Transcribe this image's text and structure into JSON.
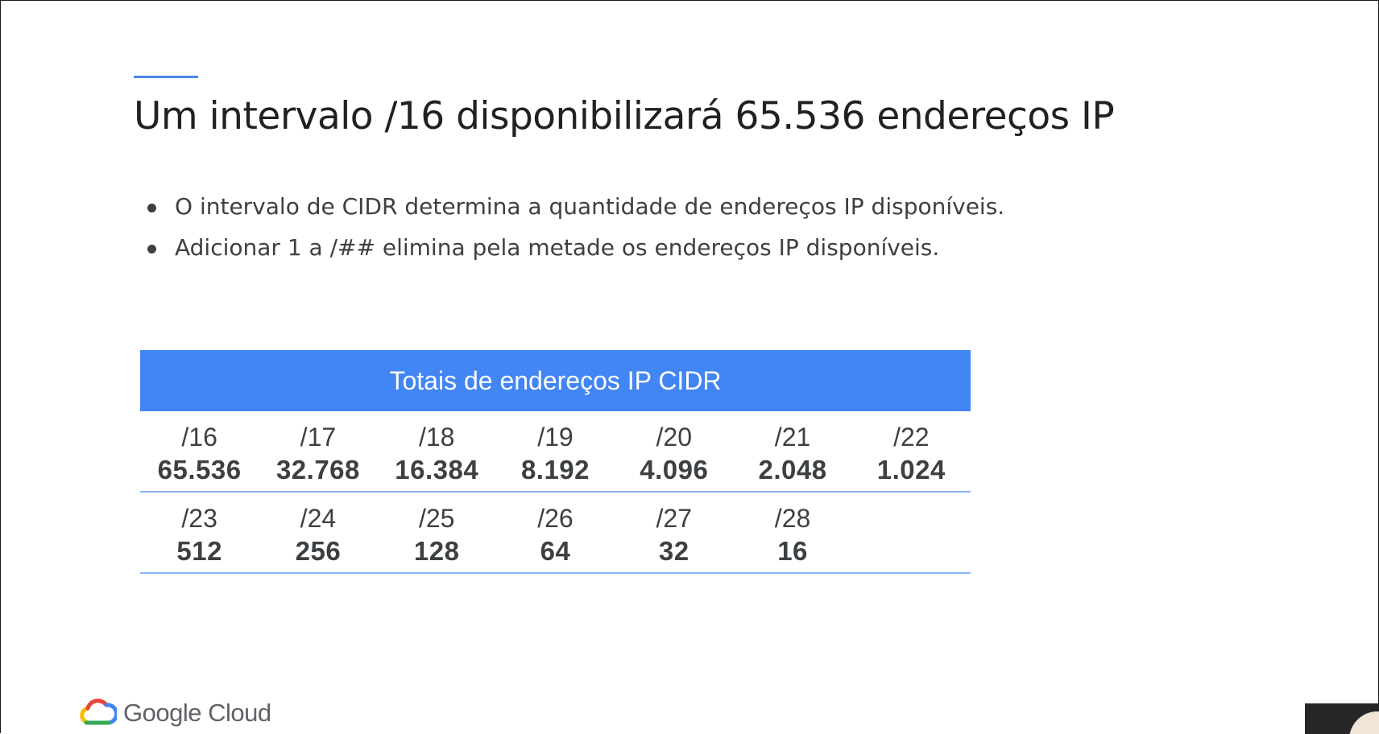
{
  "slide": {
    "title": "Um intervalo /16 disponibilizará 65.536 endereços IP",
    "bullets": [
      "O intervalo de CIDR determina a quantidade de endereços IP disponíveis.",
      "Adicionar 1 a /## elimina pela metade os endereços IP disponíveis."
    ]
  },
  "table": {
    "header": "Totais de endereços IP CIDR",
    "rows": [
      [
        {
          "prefix": "/16",
          "count": "65.536"
        },
        {
          "prefix": "/17",
          "count": "32.768"
        },
        {
          "prefix": "/18",
          "count": "16.384"
        },
        {
          "prefix": "/19",
          "count": "8.192"
        },
        {
          "prefix": "/20",
          "count": "4.096"
        },
        {
          "prefix": "/21",
          "count": "2.048"
        },
        {
          "prefix": "/22",
          "count": "1.024"
        }
      ],
      [
        {
          "prefix": "/23",
          "count": "512"
        },
        {
          "prefix": "/24",
          "count": "256"
        },
        {
          "prefix": "/25",
          "count": "128"
        },
        {
          "prefix": "/26",
          "count": "64"
        },
        {
          "prefix": "/27",
          "count": "32"
        },
        {
          "prefix": "/28",
          "count": "16"
        }
      ]
    ]
  },
  "brand": {
    "logo_icon": "google-cloud-logo-icon",
    "text": "Google Cloud"
  },
  "colors": {
    "accent": "#4285f4",
    "accent_line": "#4a86e8",
    "row_divider": "#8ab4f8",
    "text": "#3c4043"
  }
}
